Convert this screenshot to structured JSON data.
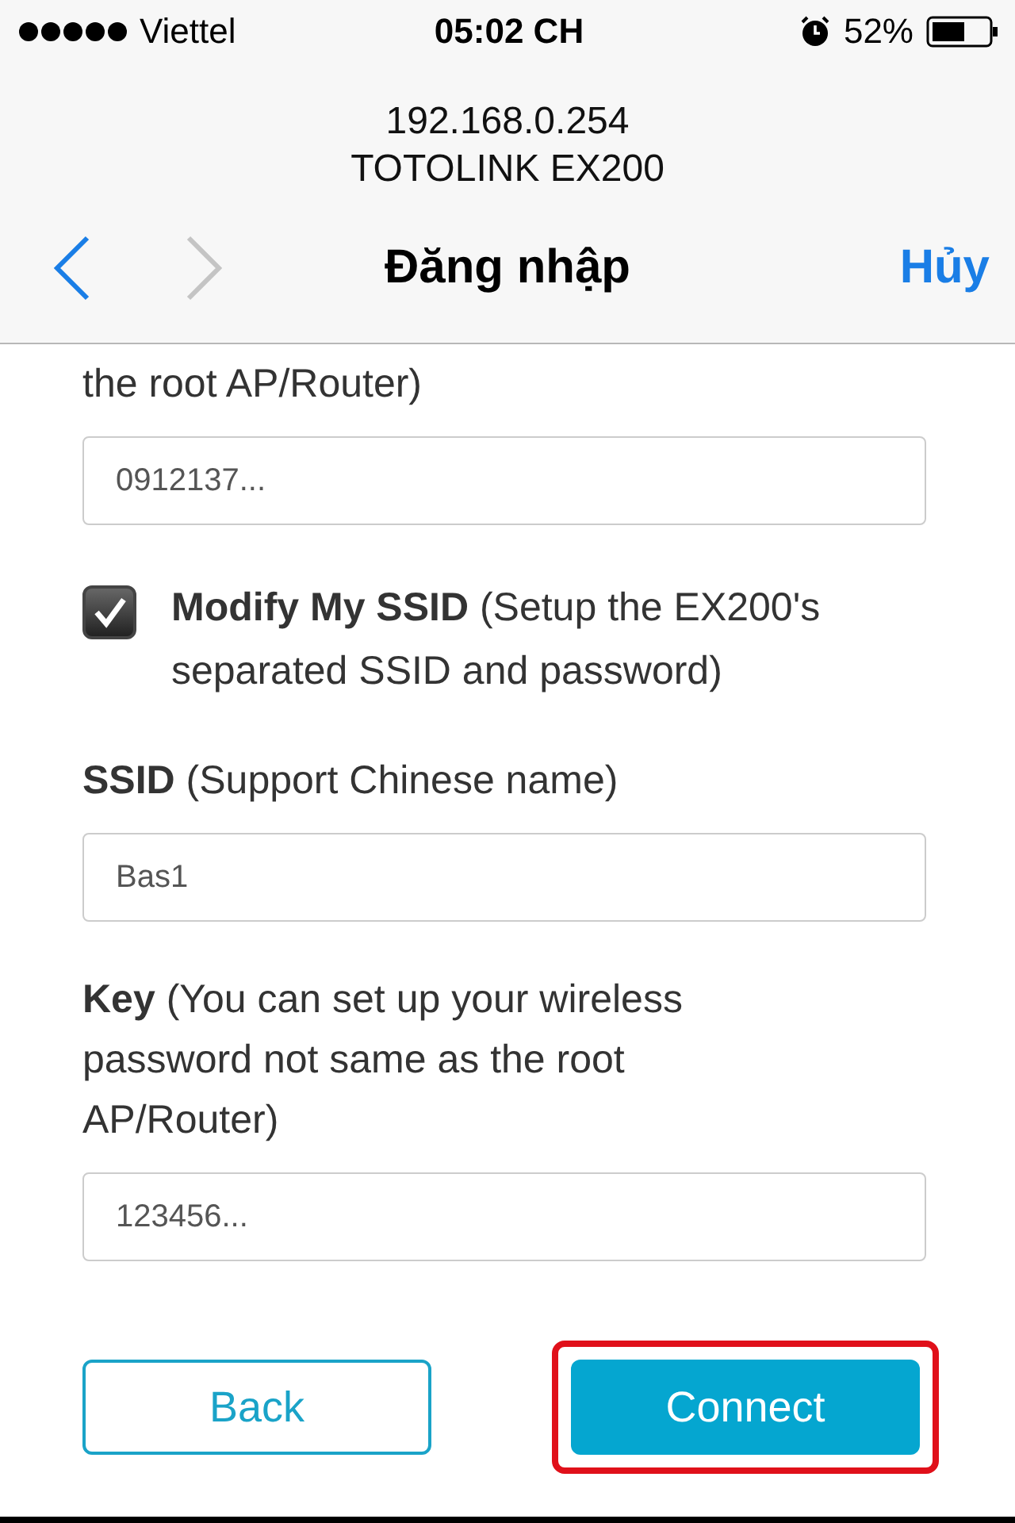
{
  "status_bar": {
    "carrier": "Viettel",
    "time": "05:02 CH",
    "battery": "52%"
  },
  "address": {
    "host": "192.168.0.254",
    "page_title": "TOTOLINK EX200"
  },
  "nav": {
    "back_enabled": true,
    "forward_enabled": false,
    "title": "Đăng nhập",
    "cancel": "Hủy"
  },
  "form": [
    {
      "kind": "label",
      "text": "the root AP/Router)"
    },
    {
      "kind": "field",
      "value": "0912137..."
    },
    {
      "kind": "checkbox",
      "checked": true,
      "text": "**Modify My SSID** (Setup the EX200's separated SSID and password)"
    },
    {
      "kind": "label",
      "text": "**SSID** (Support Chinese name)"
    },
    {
      "kind": "field",
      "value": "Bas1"
    },
    {
      "kind": "label",
      "text": "**Key** (You can set up your wireless password not same as the root AP/Router)"
    },
    {
      "kind": "field",
      "value": "123456..."
    }
  ],
  "buttons": [
    {
      "kind": "secondary",
      "label": "Back",
      "highlighted": false
    },
    {
      "kind": "primary",
      "label": "Connect",
      "highlighted": true
    }
  ]
}
